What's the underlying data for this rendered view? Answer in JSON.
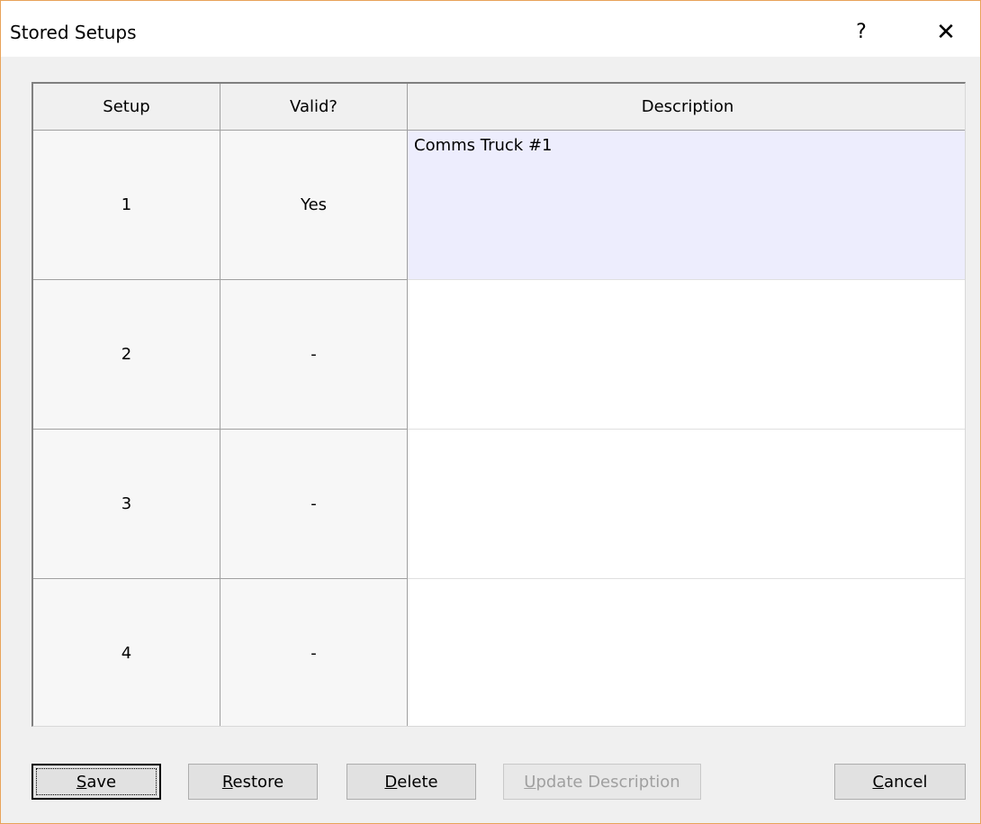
{
  "window": {
    "title": "Stored Setups",
    "help_icon": "?",
    "close_icon": "✕"
  },
  "table": {
    "columns": [
      "Setup",
      "Valid?",
      "Description"
    ],
    "rows": [
      {
        "setup": "1",
        "valid": "Yes",
        "description": "Comms Truck #1",
        "selected": true
      },
      {
        "setup": "2",
        "valid": "-",
        "description": "",
        "selected": false
      },
      {
        "setup": "3",
        "valid": "-",
        "description": "",
        "selected": false
      },
      {
        "setup": "4",
        "valid": "-",
        "description": "",
        "selected": false
      }
    ]
  },
  "buttons": {
    "save": {
      "accel": "S",
      "rest": "ave"
    },
    "restore": {
      "accel": "R",
      "rest": "estore"
    },
    "delete": {
      "accel": "D",
      "rest": "elete"
    },
    "update_description": {
      "accel": "U",
      "rest": "pdate Description"
    },
    "cancel": {
      "accel": "C",
      "rest": "ancel"
    }
  },
  "colors": {
    "selected_row": "#ededfd",
    "window_border": "#e8a35a"
  }
}
